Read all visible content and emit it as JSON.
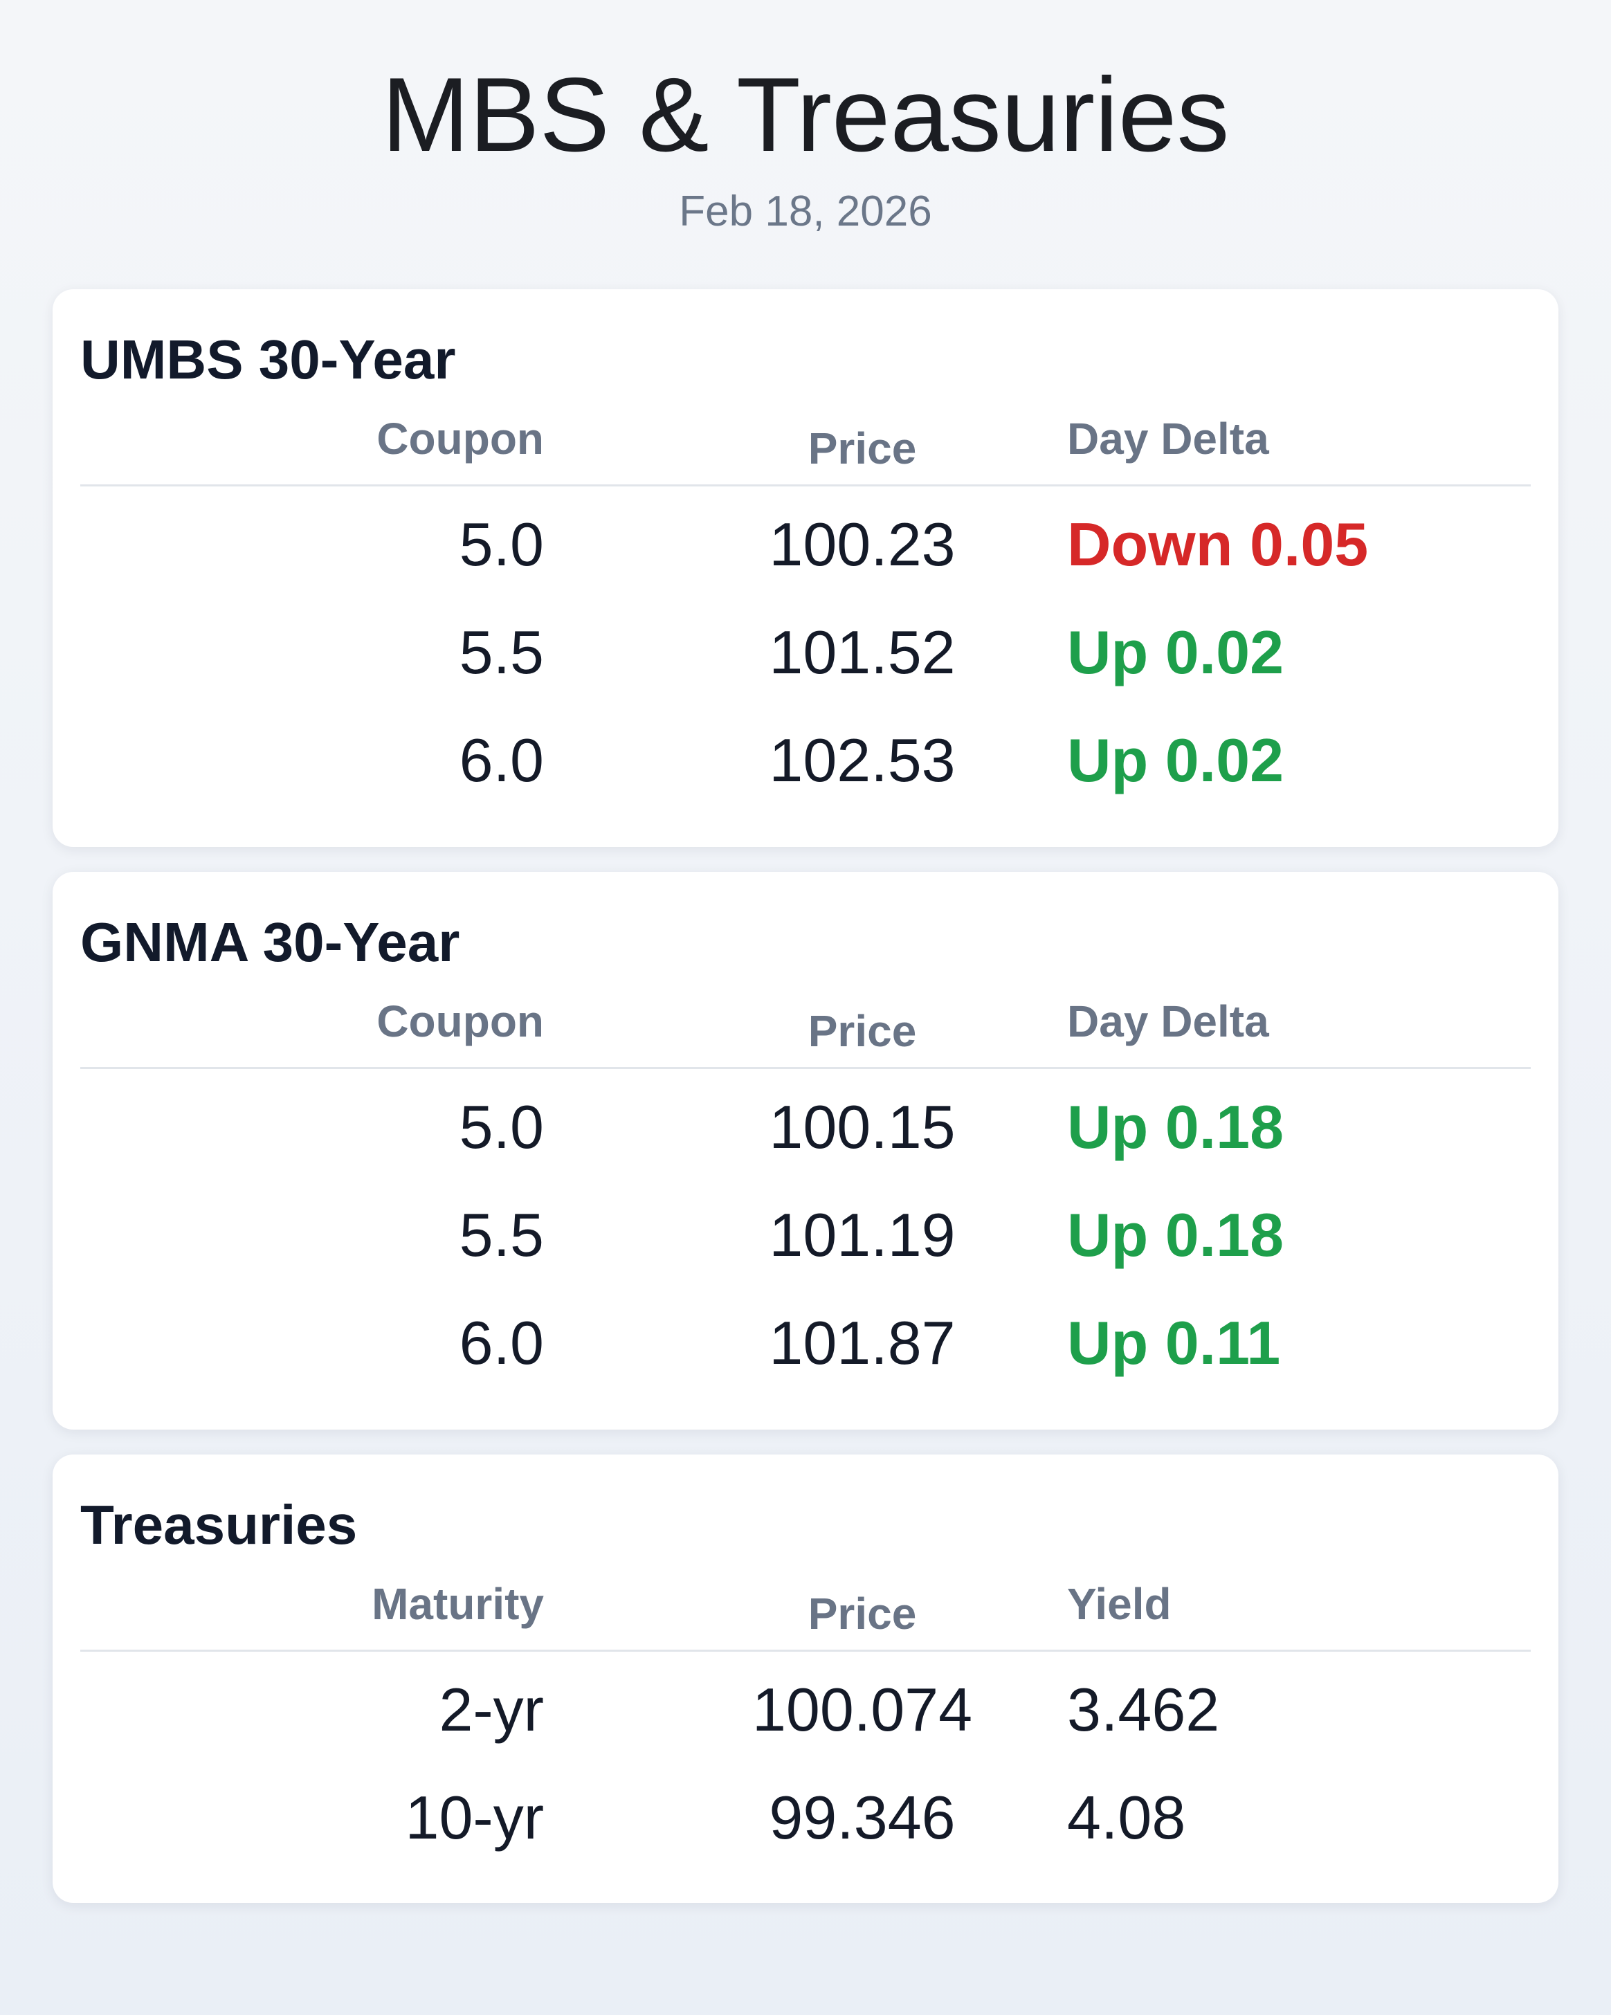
{
  "header": {
    "title": "MBS & Treasuries",
    "date": "Feb 18, 2026"
  },
  "colors": {
    "up": "#1e9f4b",
    "down": "#d62828",
    "muted": "#697486",
    "text": "#141a28"
  },
  "umbs": {
    "title": "UMBS 30-Year",
    "columns": [
      "Coupon",
      "Price",
      "Day Delta"
    ],
    "rows": [
      {
        "coupon": "5.0",
        "price": "100.23",
        "delta": "Down 0.05",
        "direction": "down"
      },
      {
        "coupon": "5.5",
        "price": "101.52",
        "delta": "Up 0.02",
        "direction": "up"
      },
      {
        "coupon": "6.0",
        "price": "102.53",
        "delta": "Up 0.02",
        "direction": "up"
      }
    ]
  },
  "gnma": {
    "title": "GNMA 30-Year",
    "columns": [
      "Coupon",
      "Price",
      "Day Delta"
    ],
    "rows": [
      {
        "coupon": "5.0",
        "price": "100.15",
        "delta": "Up 0.18",
        "direction": "up"
      },
      {
        "coupon": "5.5",
        "price": "101.19",
        "delta": "Up 0.18",
        "direction": "up"
      },
      {
        "coupon": "6.0",
        "price": "101.87",
        "delta": "Up 0.11",
        "direction": "up"
      }
    ]
  },
  "treasuries": {
    "title": "Treasuries",
    "columns": [
      "Maturity",
      "Price",
      "Yield"
    ],
    "rows": [
      {
        "maturity": "2-yr",
        "price": "100.074",
        "yield": "3.462"
      },
      {
        "maturity": "10-yr",
        "price": "99.346",
        "yield": "4.08"
      }
    ]
  }
}
